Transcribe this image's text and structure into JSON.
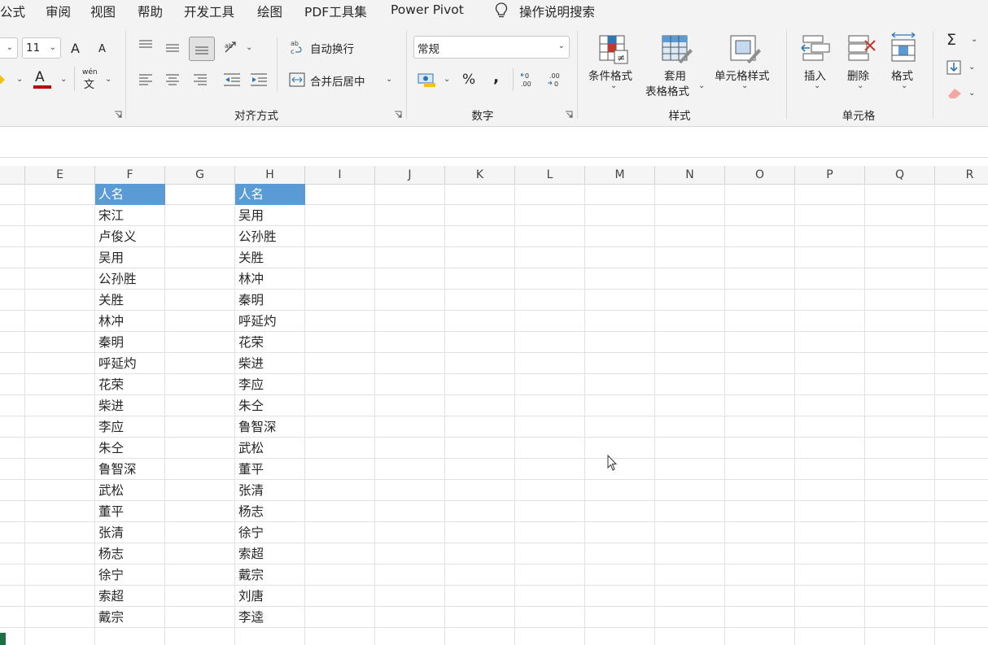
{
  "menu": {
    "tabs": [
      "公式",
      "审阅",
      "视图",
      "帮助",
      "开发工具",
      "绘图",
      "PDF工具集",
      "Power Pivot"
    ],
    "search_label": "操作说明搜索"
  },
  "font": {
    "size": "11",
    "grow_label": "A",
    "shrink_label": "A",
    "color_label": "A",
    "phonetic_top": "wén",
    "phonetic_char": "文"
  },
  "alignment": {
    "wrap_label": "自动换行",
    "merge_label": "合并后居中",
    "group_label": "对齐方式"
  },
  "number": {
    "format": "常规",
    "percent_label": "%",
    "comma_label": ",",
    "dec_inc_label": "←0 .00",
    "dec_dec_label": ".00 →0",
    "group_label": "数字"
  },
  "styles": {
    "conditional_label": "条件格式",
    "table_label_1": "套用",
    "table_label_2": "表格格式",
    "cell_style_label": "单元格样式",
    "group_label": "样式"
  },
  "cells": {
    "insert_label": "插入",
    "delete_label": "删除",
    "format_label": "格式",
    "group_label": "单元格"
  },
  "editing": {
    "sum_label": "Σ"
  },
  "columns": [
    "E",
    "F",
    "G",
    "H",
    "I",
    "J",
    "K",
    "L",
    "M",
    "N",
    "O",
    "P",
    "Q",
    "R"
  ],
  "sheet": {
    "col_f": [
      "人名",
      "宋江",
      "卢俊义",
      "吴用",
      "公孙胜",
      "关胜",
      "林冲",
      "秦明",
      "呼延灼",
      "花荣",
      "柴进",
      "李应",
      "朱仝",
      "鲁智深",
      "武松",
      "董平",
      "张清",
      "杨志",
      "徐宁",
      "索超",
      "戴宗"
    ],
    "col_h": [
      "人名",
      "吴用",
      "公孙胜",
      "关胜",
      "林冲",
      "秦明",
      "呼延灼",
      "花荣",
      "柴进",
      "李应",
      "朱仝",
      "鲁智深",
      "武松",
      "董平",
      "张清",
      "杨志",
      "徐宁",
      "索超",
      "戴宗",
      "刘唐",
      "李逵"
    ]
  },
  "colors": {
    "header_fill": "#5b9bd5",
    "header_text": "#ffffff",
    "font_color_bar": "#c00000"
  }
}
